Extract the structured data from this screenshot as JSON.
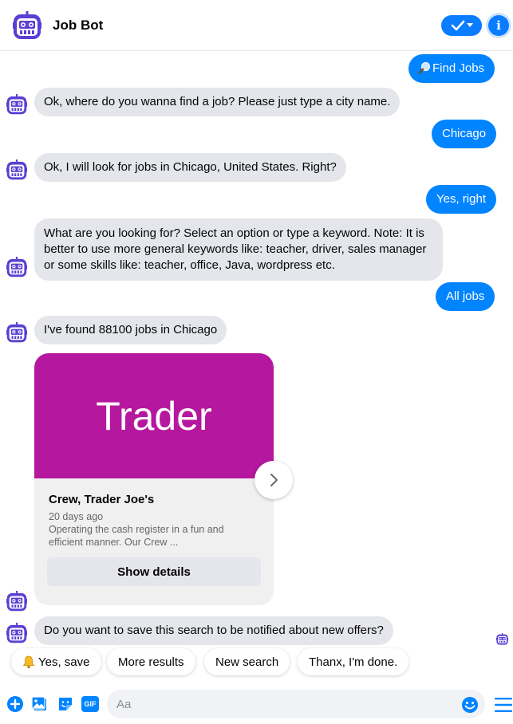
{
  "header": {
    "title": "Job Bot",
    "info_label": "i"
  },
  "messages": [
    {
      "from": "user",
      "icon": "magnifier-icon",
      "text": "Find Jobs"
    },
    {
      "from": "bot",
      "text": "Ok, where do you wanna find a job? Please just type a city name."
    },
    {
      "from": "user",
      "text": "Chicago"
    },
    {
      "from": "bot",
      "text": "Ok, I will look for jobs in Chicago, United States. Right?"
    },
    {
      "from": "user",
      "text": "Yes, right"
    },
    {
      "from": "bot",
      "lines": [
        "What are you looking for? Select an option or type a keyword. Note: It is",
        "better to use more general keywords like: teacher, driver, sales manager",
        "or some skills like: teacher, office, Java, wordpress etc."
      ]
    },
    {
      "from": "user",
      "text": "All jobs"
    },
    {
      "from": "bot",
      "text": "I've found 88100 jobs in Chicago"
    },
    {
      "from": "bot",
      "text": "Do you want to save this search to be notified about new offers?"
    }
  ],
  "job_card": {
    "image_text": "Trader",
    "image_color": "#b5179e",
    "title": "Crew, Trader Joe's",
    "posted": "20 days ago",
    "description_lines": [
      "Operating the cash register in a fun and",
      "efficient manner. Our Crew ..."
    ],
    "button_label": "Show details"
  },
  "quick_replies": [
    {
      "icon": "bell-icon",
      "label": "Yes, save"
    },
    {
      "label": "More results"
    },
    {
      "label": "New search"
    },
    {
      "label": "Thanx, I'm done."
    }
  ],
  "composer": {
    "placeholder": "Aa",
    "icons": [
      "plus-icon",
      "image-icon",
      "sticker-icon",
      "gif-icon",
      "emoji-icon",
      "menu-icon"
    ],
    "gif_label": "GIF"
  },
  "colors": {
    "accent": "#0084ff",
    "bot_bubble": "#e4e6eb",
    "avatar": "#5b3fd3"
  }
}
